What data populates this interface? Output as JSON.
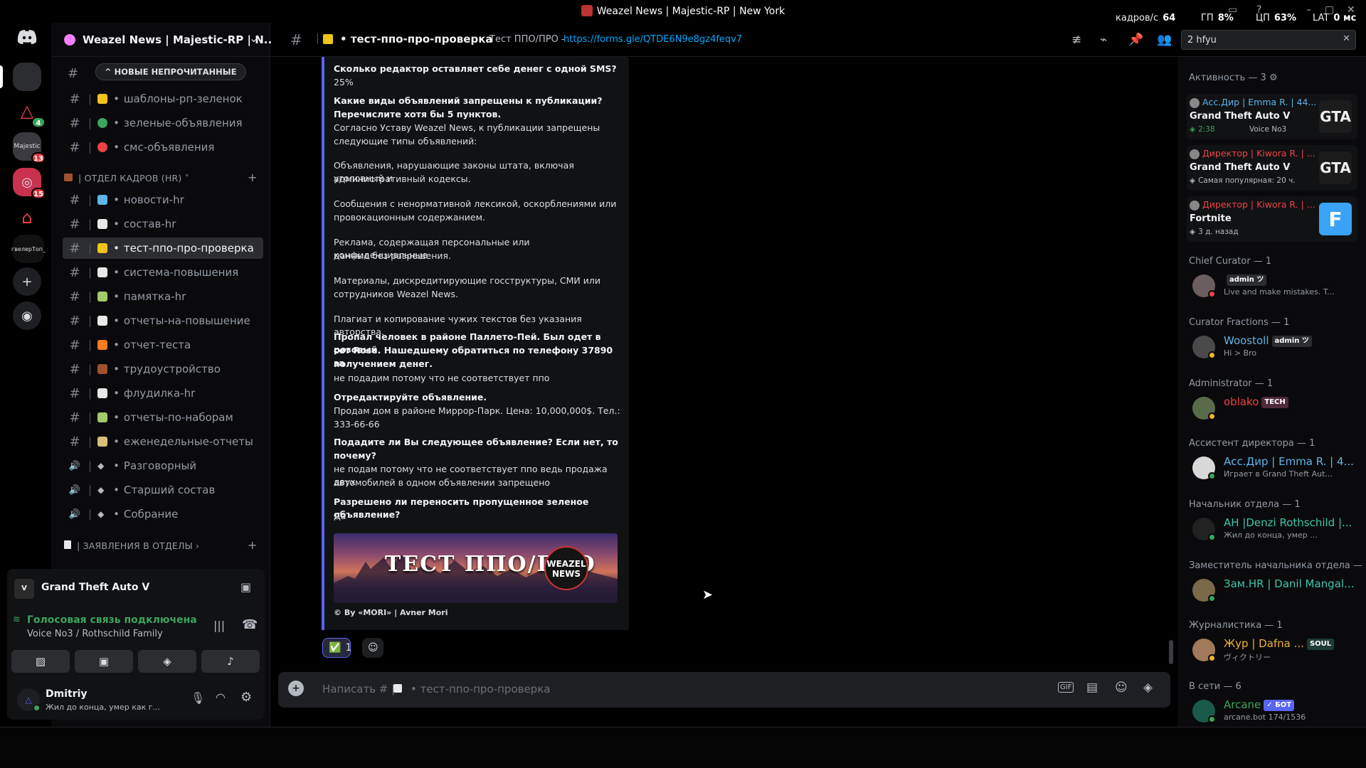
{
  "window": {
    "title": "Weazel News | Majestic-RP | New York"
  },
  "overlay_stats": [
    {
      "label": "кадров/с",
      "value": "64"
    },
    {
      "label": "ГП",
      "value": "8%"
    },
    {
      "label": "ЦП",
      "value": "63%"
    },
    {
      "label": "LAT",
      "value": "0 мс"
    }
  ],
  "server": {
    "name": "Weazel News | Majestic-RP | N..."
  },
  "rail": {
    "servers": [
      {
        "name": "server-1",
        "badge": ""
      },
      {
        "name": "server-2",
        "badge": "4"
      },
      {
        "name": "server-majestic",
        "badge": "13"
      },
      {
        "name": "server-4",
        "badge": "15"
      },
      {
        "name": "server-5",
        "badge": ""
      },
      {
        "name": "server-6",
        "label": "гвелерТоп_"
      }
    ]
  },
  "sidebar": {
    "new_unread": "^ НОВЫЕ НЕПРОЧИТАННЫЕ",
    "top_channels": [
      {
        "name": "шаблоны-рп-зеленок",
        "color": "#f0c419"
      },
      {
        "name": "зеленые-объявления",
        "color": "#3ba55c"
      },
      {
        "name": "смс-объявления",
        "color": "#ed4245"
      }
    ],
    "category_hr": "| ОТДЕЛ КАДРОВ (HR) ˅",
    "hr_channels": [
      {
        "name": "новости-hr",
        "color": "#5fb4e8"
      },
      {
        "name": "состав-hr",
        "color": "#e8e8e8"
      },
      {
        "name": "тест-ппо-про-проверка",
        "color": "#f0c419"
      },
      {
        "name": "система-повышения",
        "color": "#e8e8e8"
      },
      {
        "name": "памятка-hr",
        "color": "#a3c96b"
      },
      {
        "name": "отчеты-на-повышение",
        "color": "#e8e8e8"
      },
      {
        "name": "отчет-теста",
        "color": "#f57c1f"
      },
      {
        "name": "трудоустройство",
        "color": "#a0522d"
      },
      {
        "name": "флудилка-hr",
        "color": "#e8e8e8"
      },
      {
        "name": "отчеты-по-наборам",
        "color": "#a3c96b"
      },
      {
        "name": "еженедельные-отчеты",
        "color": "#d8c07a"
      }
    ],
    "voice_channels": [
      {
        "name": "Разговорный"
      },
      {
        "name": "Старший состав"
      },
      {
        "name": "Собрание"
      }
    ],
    "category_apps": "| ЗАЯВЛЕНИЯ В ОТДЕЛЫ ›"
  },
  "activity_panel": {
    "game": "Grand Theft Auto V"
  },
  "voice": {
    "status": "Голосовая связь подключена",
    "channel": "Voice No3 / Rothschild Family"
  },
  "user": {
    "name": "Dmitriy",
    "status": "Жил до конца, умер как г..."
  },
  "topbar": {
    "channel": "тест-ппо-про-проверка",
    "topic": "Тест ППО/ПРО -",
    "link": "https://forms.gle/QTDE6N9e8gz4feqv7",
    "search_value": "2 hfyu"
  },
  "embed_lines": [
    {
      "text": "Сколько редактор оставляет себе денег с одной SMS?",
      "bold": true
    },
    {
      "text": "25%",
      "bold": false
    },
    {
      "text": "Какие виды объявлений запрещены к публикации?",
      "bold": true
    },
    {
      "text": "Перечислите хотя бы 5 пунктов.",
      "bold": true
    },
    {
      "text": "Согласно Уставу Weazel News, к публикации запрещены",
      "bold": false
    },
    {
      "text": "следующие типы объявлений:",
      "bold": false
    },
    {
      "text": "Объявления, нарушающие законы штата, включая уголовный и",
      "bold": false
    },
    {
      "text": "административный кодексы.",
      "bold": false
    },
    {
      "text": "Сообщения с ненормативной лексикой, оскорблениями или",
      "bold": false
    },
    {
      "text": "провокационным содержанием.",
      "bold": false
    },
    {
      "text": "Реклама, содержащая персональные или конфиденциальные",
      "bold": false
    },
    {
      "text": "данные без разрешения.",
      "bold": false
    },
    {
      "text": "Материалы, дискредитирующие госструктуры, СМИ или",
      "bold": false
    },
    {
      "text": "сотрудников Weazel News.",
      "bold": false
    },
    {
      "text": "Плагиат и копирование чужих текстов без указания авторства.",
      "bold": false
    },
    {
      "text": "Пропал человек в районе Паллето-Пей. Был одет в розовый",
      "bold": true
    },
    {
      "text": "сет Rose. Нашедшему обратиться по телефону 37890 за",
      "bold": true
    },
    {
      "text": "получением денег.",
      "bold": true
    },
    {
      "text": "не подадим потому что не соответствует ппо",
      "bold": false
    },
    {
      "text": "Отредактируйте объявление.",
      "bold": true
    },
    {
      "text": "Продам дом в районе Миррор-Парк. Цена: 10,000,000$. Тел.:",
      "bold": false
    },
    {
      "text": "333-66-66",
      "bold": false
    },
    {
      "text": "Подадите ли Вы следующее объявление? Если нет, то",
      "bold": true
    },
    {
      "text": "почему?",
      "bold": true
    },
    {
      "text": "не подам потому что не соответствует ппо ведь продажа двух",
      "bold": false
    },
    {
      "text": "автомобилей в одном объявлении запрещено",
      "bold": false
    },
    {
      "text": "Разрешено ли переносить пропущенное зеленое объявление?",
      "bold": true
    },
    {
      "text": "Да",
      "bold": false
    }
  ],
  "banner": {
    "text": "ТЕСТ ППО/ПРО",
    "logo": "WEAZEL NEWS"
  },
  "embed_footer": "© By «MORI» | Avner Mori",
  "reaction": {
    "emoji": "✅",
    "count": "1"
  },
  "composer": {
    "placeholder": "Написать # |",
    "channel": "тест-ппо-про-проверка"
  },
  "members": {
    "activity_header": "Активность — 3",
    "activity_cards": [
      {
        "name": "Асс.Дир | Emma R. | 44...",
        "color": "#5fb4e8",
        "game": "Grand Theft Auto V",
        "detail": "2:38",
        "extra": "Voice No3",
        "icon": "GTA"
      },
      {
        "name": "Директор | Kiwora R. | ...",
        "color": "#ed4245",
        "game": "Grand Theft Auto V",
        "detail": "Самая популярная: 20 ч.",
        "extra": "",
        "icon": "GTA"
      },
      {
        "name": "Директор | Kiwora R. | ...",
        "color": "#ed4245",
        "game": "Fortnite",
        "detail": "3 д. назад",
        "extra": "",
        "icon": "F"
      }
    ],
    "groups": [
      {
        "header": "Chief Curator — 1",
        "members": [
          {
            "name": "",
            "tag": "admin ツ",
            "tag_color": "#2b2d31",
            "color": "#dbdee1",
            "sub": "Live and make mistakes. T...",
            "status": "#ed4245"
          }
        ]
      },
      {
        "header": "Curator Fractions — 1",
        "members": [
          {
            "name": "Woostoll",
            "tag": "admin ツ",
            "tag_color": "#2b2d31",
            "color": "#5fb4e8",
            "sub": "Hi > Bro",
            "status": "#f0b232"
          }
        ]
      },
      {
        "header": "Administrator — 1",
        "members": [
          {
            "name": "oblako",
            "tag": "TECH",
            "tag_color": "#4e2a3a",
            "color": "#ed4245",
            "sub": "",
            "status": "#f0b232"
          }
        ]
      },
      {
        "header": "Ассистент директора — 1",
        "members": [
          {
            "name": "Асс.Дир | Emma R. | 4...",
            "tag": "",
            "tag_color": "",
            "color": "#5fb4e8",
            "sub": "Играет в Grand Theft Aut...",
            "status": "#3ba55c"
          }
        ]
      },
      {
        "header": "Начальник отдела — 1",
        "members": [
          {
            "name": "AH |Denzi Rothschild |...",
            "tag": "",
            "tag_color": "",
            "color": "#3ec6a8",
            "sub": "Жил до конца, умер ...",
            "status": "#3ba55c"
          }
        ]
      },
      {
        "header": "Заместитель начальника отдела — 1",
        "members": [
          {
            "name": "Зам.HR | Danil Mangal...",
            "tag": "",
            "tag_color": "",
            "color": "#3ec6a8",
            "sub": "",
            "status": "#3ba55c"
          }
        ]
      },
      {
        "header": "Журналистика — 1",
        "members": [
          {
            "name": "Жур | Dafna ...",
            "tag": "SOUL",
            "tag_color": "#1f3b35",
            "color": "#f0b232",
            "sub": "ヴィクトリー",
            "status": "#f0b232"
          }
        ]
      },
      {
        "header": "В сети — 6",
        "members": [
          {
            "name": "Arcane",
            "tag": "✓ БОТ",
            "tag_color": "#5865f2",
            "color": "#3ba55c",
            "sub": "arcane.bot 174/1536",
            "status": "#3ba55c"
          }
        ]
      }
    ]
  }
}
